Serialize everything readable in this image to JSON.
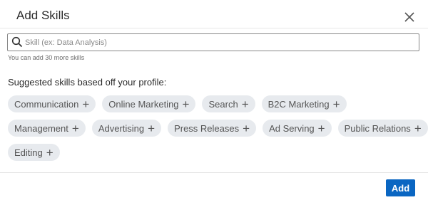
{
  "dialog": {
    "title": "Add Skills",
    "close_icon": "close-icon"
  },
  "search": {
    "icon": "search-icon",
    "placeholder": "Skill (ex: Data Analysis)",
    "value": "",
    "helper": "You can add 30 more skills"
  },
  "suggestions": {
    "heading": "Suggested skills based off your profile:",
    "rows": [
      [
        "Communication",
        "Online Marketing",
        "Search",
        "B2C Marketing"
      ],
      [
        "Management",
        "Advertising",
        "Press Releases",
        "Ad Serving",
        "Public Relations"
      ],
      [
        "Editing"
      ]
    ],
    "add_glyph": "+"
  },
  "footer": {
    "add_label": "Add"
  },
  "colors": {
    "primary": "#0a66c2",
    "chip_bg": "#e7eaee"
  }
}
